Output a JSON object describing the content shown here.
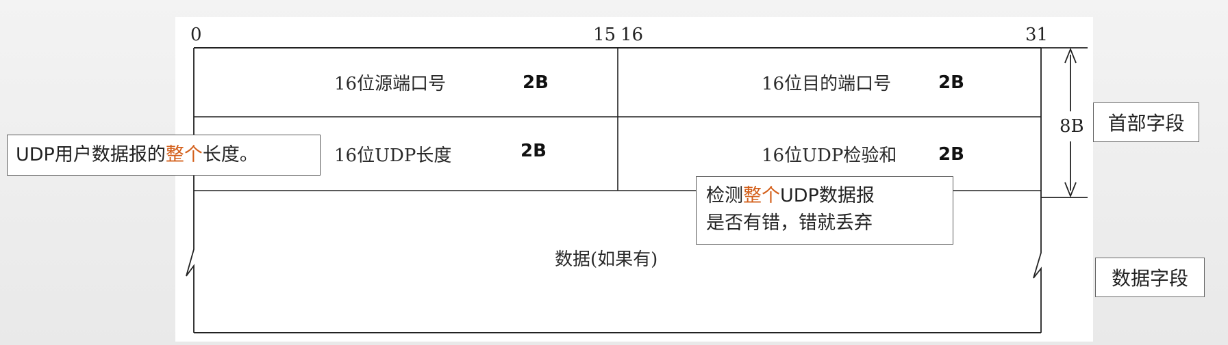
{
  "bits": {
    "start": "0",
    "mid_left": "15",
    "mid_right": "16",
    "end": "31"
  },
  "header": {
    "row1": {
      "left_label": "16位源端口号",
      "left_size": "2B",
      "right_label": "16位目的端口号",
      "right_size": "2B"
    },
    "row2": {
      "left_label": "16位UDP长度",
      "left_size": "2B",
      "right_label": "16位UDP检验和",
      "right_size": "2B"
    },
    "total_size": "8B"
  },
  "data_field": {
    "label": "数据(如果有)"
  },
  "side_labels": {
    "header_fields": "首部字段",
    "data_fields": "数据字段"
  },
  "callouts": {
    "length": {
      "prefix": "UDP用户数据报的",
      "highlight": "整个",
      "suffix": "长度。"
    },
    "checksum": {
      "line1_prefix": "检测",
      "line1_highlight": "整个",
      "line1_suffix": "UDP数据报",
      "line2": "是否有错，错就丢弃"
    }
  },
  "colors": {
    "highlight": "#d35f1a",
    "line": "#222222"
  }
}
